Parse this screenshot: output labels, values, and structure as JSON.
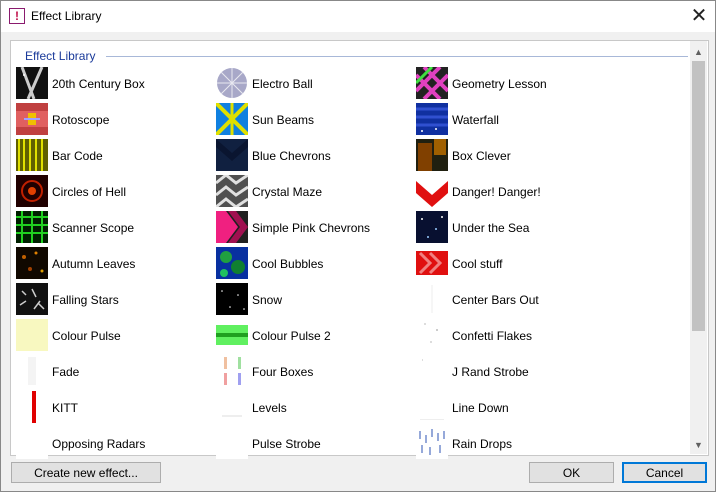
{
  "window": {
    "title": "Effect Library",
    "icon_glyph": "!"
  },
  "panel": {
    "group_label": "Effect Library"
  },
  "effects": [
    [
      "20th Century Box",
      "Electro Ball",
      "Geometry Lesson"
    ],
    [
      "Rotoscope",
      "Sun Beams",
      "Waterfall"
    ],
    [
      "Bar Code",
      "Blue Chevrons",
      "Box Clever"
    ],
    [
      "Circles of Hell",
      "Crystal Maze",
      "Danger! Danger!"
    ],
    [
      "Scanner Scope",
      "Simple Pink Chevrons",
      "Under the Sea"
    ],
    [
      "Autumn Leaves",
      "Cool Bubbles",
      "Cool stuff"
    ],
    [
      "Falling Stars",
      "Snow",
      "Center Bars Out"
    ],
    [
      "Colour Pulse",
      "Colour Pulse 2",
      "Confetti Flakes"
    ],
    [
      "Fade",
      "Four Boxes",
      "J Rand Strobe"
    ],
    [
      "KITT",
      "Levels",
      "Line Down"
    ],
    [
      "Opposing Radars",
      "Pulse Strobe",
      "Rain Drops"
    ]
  ],
  "buttons": {
    "create": "Create new effect...",
    "ok": "OK",
    "cancel": "Cancel"
  },
  "glyphs": {
    "close": "✕",
    "scroll_up": "▲",
    "scroll_down": "▼"
  }
}
